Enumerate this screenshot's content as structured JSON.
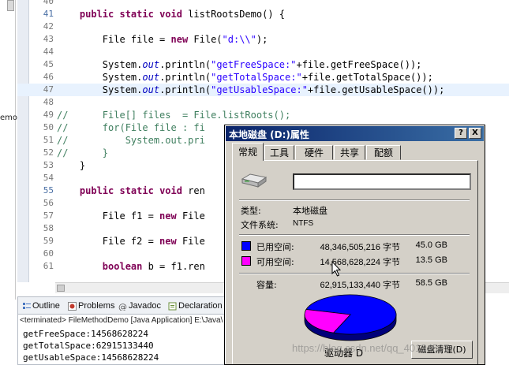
{
  "left_panel": {
    "fragment": "emo"
  },
  "editor": {
    "lines": [
      {
        "n": "40",
        "fold": false,
        "hl": false,
        "tokens": []
      },
      {
        "n": "41",
        "fold": true,
        "hl": false,
        "tokens": [
          [
            "kw",
            "public "
          ],
          [
            "kw",
            "static "
          ],
          [
            "kw",
            "void "
          ],
          [
            "",
            "listRootsDemo() {"
          ]
        ],
        "indent": "    "
      },
      {
        "n": "42",
        "fold": false,
        "hl": false,
        "tokens": []
      },
      {
        "n": "43",
        "fold": false,
        "hl": false,
        "tokens": [
          [
            "",
            "File file = "
          ],
          [
            "kw",
            "new "
          ],
          [
            "",
            "File("
          ],
          [
            "str",
            "\"d:\\\\\""
          ],
          [
            "",
            ");"
          ]
        ],
        "indent": "        "
      },
      {
        "n": "44",
        "fold": false,
        "hl": false,
        "tokens": []
      },
      {
        "n": "45",
        "fold": false,
        "hl": false,
        "tokens": [
          [
            "",
            "System."
          ],
          [
            "fld",
            "out"
          ],
          [
            "",
            ".println("
          ],
          [
            "str",
            "\"getFreeSpace:\""
          ],
          [
            "",
            "+file.getFreeSpace());"
          ]
        ],
        "indent": "        "
      },
      {
        "n": "46",
        "fold": false,
        "hl": false,
        "tokens": [
          [
            "",
            "System."
          ],
          [
            "fld",
            "out"
          ],
          [
            "",
            ".println("
          ],
          [
            "str",
            "\"getTotalSpace:\""
          ],
          [
            "",
            "+file.getTotalSpace());"
          ]
        ],
        "indent": "        "
      },
      {
        "n": "47",
        "fold": false,
        "hl": true,
        "tokens": [
          [
            "",
            "System."
          ],
          [
            "fld",
            "out"
          ],
          [
            "",
            ".println("
          ],
          [
            "str",
            "\"getUsableSpace:\""
          ],
          [
            "",
            "+file.getUsableSpace());"
          ]
        ],
        "indent": "        "
      },
      {
        "n": "48",
        "fold": false,
        "hl": false,
        "tokens": []
      },
      {
        "n": "49",
        "fold": false,
        "hl": false,
        "tokens": [
          [
            "cmt",
            "//      File[] files  = File.listRoots();"
          ]
        ],
        "indent": ""
      },
      {
        "n": "50",
        "fold": false,
        "hl": false,
        "tokens": [
          [
            "cmt",
            "//      for(File file : fi"
          ]
        ],
        "indent": ""
      },
      {
        "n": "51",
        "fold": false,
        "hl": false,
        "tokens": [
          [
            "cmt",
            "//          System.out.pri"
          ]
        ],
        "indent": ""
      },
      {
        "n": "52",
        "fold": false,
        "hl": false,
        "tokens": [
          [
            "cmt",
            "//      }"
          ]
        ],
        "indent": ""
      },
      {
        "n": "53",
        "fold": false,
        "hl": false,
        "tokens": [
          [
            "",
            "}"
          ]
        ],
        "indent": "    "
      },
      {
        "n": "54",
        "fold": false,
        "hl": false,
        "tokens": []
      },
      {
        "n": "55",
        "fold": true,
        "hl": false,
        "tokens": [
          [
            "kw",
            "public "
          ],
          [
            "kw",
            "static "
          ],
          [
            "kw",
            "void "
          ],
          [
            "",
            "ren"
          ]
        ],
        "indent": "    "
      },
      {
        "n": "56",
        "fold": false,
        "hl": false,
        "tokens": []
      },
      {
        "n": "57",
        "fold": false,
        "hl": false,
        "tokens": [
          [
            "",
            "File f1 = "
          ],
          [
            "kw",
            "new "
          ],
          [
            "",
            "File"
          ]
        ],
        "indent": "        "
      },
      {
        "n": "58",
        "fold": false,
        "hl": false,
        "tokens": []
      },
      {
        "n": "59",
        "fold": false,
        "hl": false,
        "tokens": [
          [
            "",
            "File f2 = "
          ],
          [
            "kw",
            "new "
          ],
          [
            "",
            "File"
          ]
        ],
        "indent": "        "
      },
      {
        "n": "60",
        "fold": false,
        "hl": false,
        "tokens": []
      },
      {
        "n": "61",
        "fold": false,
        "hl": false,
        "tokens": [
          [
            "kw",
            "boolean "
          ],
          [
            "",
            "b = f1.ren"
          ]
        ],
        "indent": "        "
      }
    ]
  },
  "views": {
    "tabs": [
      {
        "label": "Outline",
        "icon": "outline-icon",
        "color": "#4a78c2"
      },
      {
        "label": "Problems",
        "icon": "problems-icon",
        "color": "#c0392b"
      },
      {
        "label": "Javadoc",
        "icon": "javadoc-icon",
        "color": "#555555"
      },
      {
        "label": "Declaration",
        "icon": "declaration-icon",
        "color": "#6a8f3a"
      }
    ],
    "console_header": "<terminated> FileMethodDemo [Java Application] E:\\Java\\",
    "console_lines": [
      "getFreeSpace:14568628224",
      "getTotalSpace:62915133440",
      "getUsableSpace:14568628224"
    ]
  },
  "dialog": {
    "title": "本地磁盘 (D:)属性",
    "help_glyph": "?",
    "close_glyph": "X",
    "tabs": [
      "常规",
      "工具",
      "硬件",
      "共享",
      "配额"
    ],
    "active_tab": 0,
    "name_value": "",
    "type_label": "类型:",
    "type_value": "本地磁盘",
    "fs_label": "文件系统:",
    "fs_value": "NTFS",
    "used_label": "已用空间:",
    "used_bytes": "48,346,505,216 字节",
    "used_gb": "45.0 GB",
    "free_label": "可用空间:",
    "free_bytes": "14,568,628,224 字节",
    "free_gb": "13.5 GB",
    "capacity_label": "容量:",
    "capacity_bytes": "62,915,133,440 字节",
    "capacity_gb": "58.5 GB",
    "drive_label": "驱动器 D",
    "cleanup_label": "磁盘清理(D)",
    "colors": {
      "used": "#0000ff",
      "free": "#ff00ff"
    },
    "pie": {
      "used_fraction": 0.768,
      "free_fraction": 0.232
    }
  },
  "watermark": "https://blog.csdn.net/qq_40134567"
}
